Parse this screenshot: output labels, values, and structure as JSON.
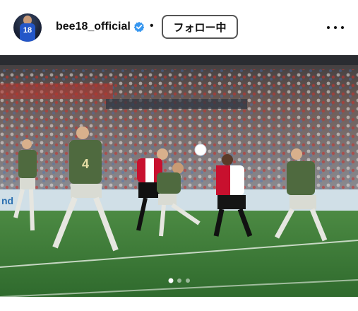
{
  "post": {
    "username": "bee18_official",
    "verified": true,
    "separator": "•",
    "follow_label": "フォロー中",
    "more_icon": "more-horizontal-icon",
    "avatar_number": "18"
  },
  "image": {
    "description_icon": "soccer-match-photo",
    "board_text": "nd",
    "jersey_number": "4",
    "carousel": {
      "count": 3,
      "active": 1
    }
  },
  "colors": {
    "pitch": "#3d7a3a",
    "away_kit": "#4f6a3f",
    "home_kit_red": "#c8102e",
    "follow_border": "#555555",
    "verified": "#3797f0"
  }
}
